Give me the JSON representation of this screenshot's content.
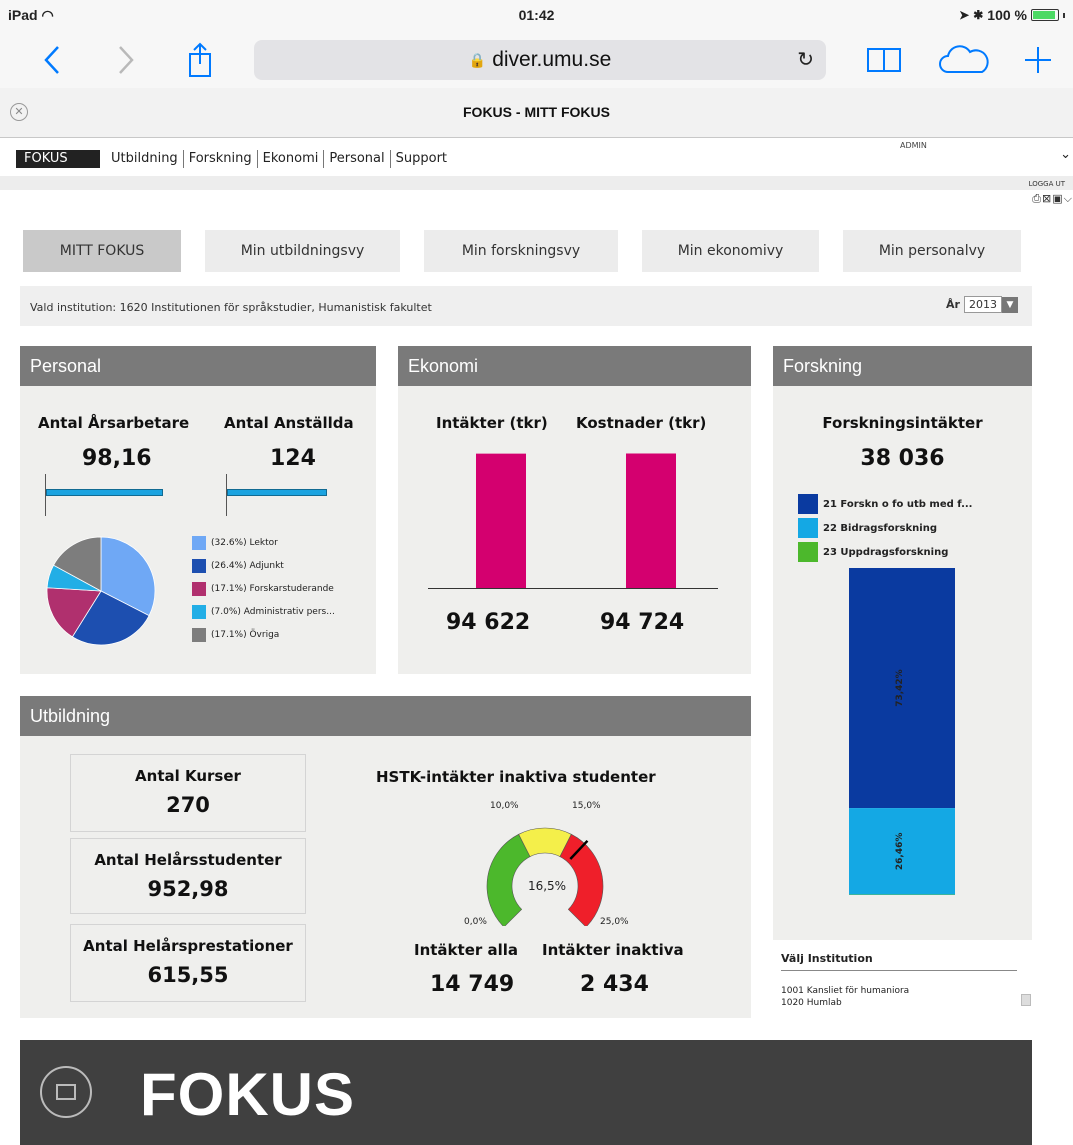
{
  "status": {
    "device": "iPad",
    "time": "01:42",
    "battery": "100 %"
  },
  "browser": {
    "url": "diver.umu.se",
    "tab_title": "FOKUS - MITT FOKUS"
  },
  "site": {
    "brand": "FOKUS",
    "nav": [
      "Utbildning",
      "Forskning",
      "Ekonomi",
      "Personal",
      "Support"
    ],
    "admin": "ADMIN",
    "logout": "LOGGA UT"
  },
  "tabs": [
    "MITT FOKUS",
    "Min utbildningsvy",
    "Min forskningsvy",
    "Min ekonomivy",
    "Min personalvy"
  ],
  "info": {
    "text": "Vald institution: 1620 Institutionen för språkstudier, Humanistisk fakultet",
    "year_label": "År",
    "year": "2013"
  },
  "personal": {
    "title": "Personal",
    "arsarbetare_label": "Antal Årsarbetare",
    "arsarbetare_value": "98,16",
    "anstallda_label": "Antal Anställda",
    "anstallda_value": "124",
    "legend": [
      "(32.6%) Lektor",
      "(26.4%) Adjunkt",
      "(17.1%) Forskarstuderande",
      "(7.0%) Administrativ pers...",
      "(17.1%) Övriga"
    ],
    "pie_colors": [
      "#6fa8f5",
      "#1d4fb0",
      "#b0306e",
      "#22aee6",
      "#7d7d7d"
    ]
  },
  "ekonomi": {
    "title": "Ekonomi",
    "intakter_label": "Intäkter (tkr)",
    "kostnader_label": "Kostnader (tkr)",
    "intakter_value": "94 622",
    "kostnader_value": "94 724",
    "bar_color": "#d4006f"
  },
  "forskning": {
    "title": "Forskning",
    "label": "Forskningsintäkter",
    "value": "38 036",
    "legend": [
      "21 Forskn o fo utb med f...",
      "22 Bidragsforskning",
      "23 Uppdragsforskning"
    ],
    "colors": [
      "#0a3aa0",
      "#14a8e4",
      "#4cb82c"
    ],
    "seg1_label": "73,42%",
    "seg2_label": "26,46%"
  },
  "utbildning": {
    "title": "Utbildning",
    "kurser_label": "Antal Kurser",
    "kurser_value": "270",
    "hst_label": "Antal Helårsstudenter",
    "hst_value": "952,98",
    "hpr_label": "Antal Helårsprestationer",
    "hpr_value": "615,55",
    "gauge_title": "HSTK-intäkter inaktiva studenter",
    "gauge_value": "16,5%",
    "gauge_ticks": [
      "0,0%",
      "10,0%",
      "15,0%",
      "25,0%"
    ],
    "alla_label": "Intäkter alla",
    "alla_value": "14 749",
    "inaktiva_label": "Intäkter inaktiva",
    "inaktiva_value": "2 434"
  },
  "institution_select": {
    "label": "Välj Institution",
    "options": [
      "1001 Kansliet för humaniora",
      "1020 Humlab"
    ]
  },
  "footer": {
    "name": "FOKUS"
  },
  "chart_data": [
    {
      "type": "pie",
      "categories": [
        "Lektor",
        "Adjunkt",
        "Forskarstuderande",
        "Administrativ pers...",
        "Övriga"
      ],
      "values": [
        32.6,
        26.4,
        17.1,
        7.0,
        17.1
      ]
    },
    {
      "type": "bar",
      "categories": [
        "Intäkter (tkr)",
        "Kostnader (tkr)"
      ],
      "values": [
        94622,
        94724
      ]
    },
    {
      "type": "bar",
      "categories": [
        "Forskningsintäkter"
      ],
      "series": [
        {
          "name": "21 Forskn o fo utb med f...",
          "values": [
            73.42
          ]
        },
        {
          "name": "22 Bidragsforskning",
          "values": [
            26.46
          ]
        },
        {
          "name": "23 Uppdragsforskning",
          "values": [
            0.12
          ]
        }
      ]
    },
    {
      "type": "gauge",
      "value": 16.5,
      "range": [
        0,
        25
      ],
      "bands": [
        [
          0,
          10,
          "#4cb82c"
        ],
        [
          10,
          15,
          "#f4ef4a"
        ],
        [
          15,
          25,
          "#ef1f2a"
        ]
      ]
    }
  ]
}
